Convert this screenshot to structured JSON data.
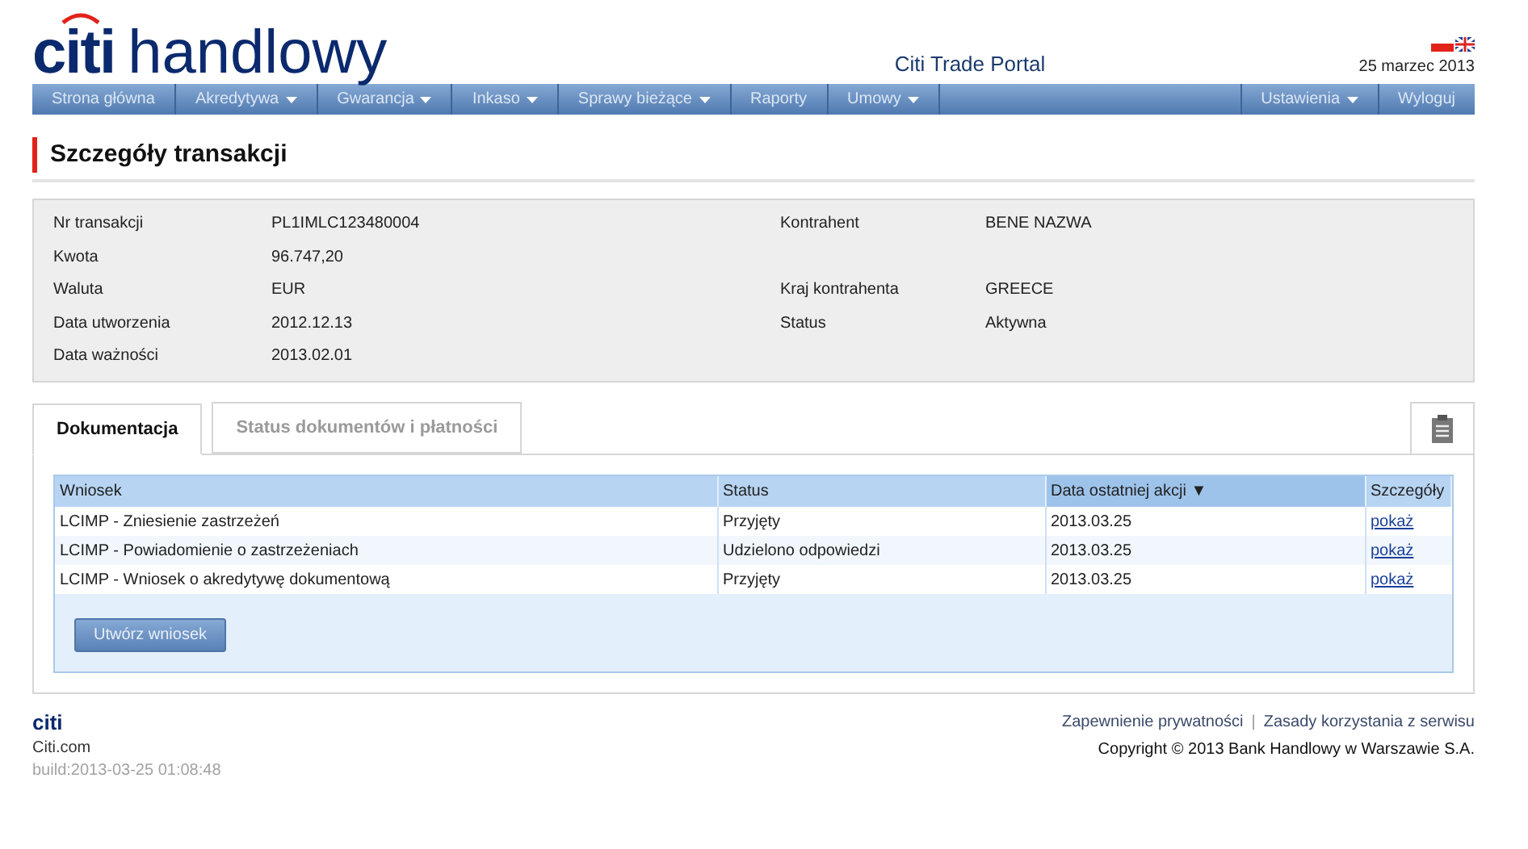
{
  "header": {
    "logo_brand": "citi",
    "logo_name": "handlowy",
    "portal_title": "Citi Trade Portal",
    "date": "25 marzec 2013"
  },
  "nav": {
    "left": [
      {
        "label": "Strona główna",
        "has_menu": false
      },
      {
        "label": "Akredytywa",
        "has_menu": true
      },
      {
        "label": "Gwarancja",
        "has_menu": true
      },
      {
        "label": "Inkaso",
        "has_menu": true
      },
      {
        "label": "Sprawy bieżące",
        "has_menu": true
      },
      {
        "label": "Raporty",
        "has_menu": false
      },
      {
        "label": "Umowy",
        "has_menu": true
      }
    ],
    "right": [
      {
        "label": "Ustawienia",
        "has_menu": true
      },
      {
        "label": "Wyloguj",
        "has_menu": false
      }
    ]
  },
  "page_title": "Szczegóły transakcji",
  "details": [
    {
      "label": "Nr transakcji",
      "value": "PL1IMLC123480004",
      "right_label": "Kontrahent",
      "right_value": "BENE NAZWA"
    },
    {
      "label": "Kwota",
      "value": "96.747,20"
    },
    {
      "label": "Waluta",
      "value": "EUR",
      "right_label": "Kraj kontrahenta",
      "right_value": "GREECE"
    },
    {
      "label": "Data utworzenia",
      "value": "2012.12.13",
      "right_label": "Status",
      "right_value": "Aktywna"
    },
    {
      "label": "Data ważności",
      "value": "2013.02.01"
    }
  ],
  "tabs": [
    {
      "label": "Dokumentacja",
      "selected": true
    },
    {
      "label": "Status dokumentów i płatności",
      "selected": false
    }
  ],
  "table": {
    "columns": [
      {
        "label": "Wniosek",
        "sorted": false
      },
      {
        "label": "Status",
        "sorted": false
      },
      {
        "label": "Data ostatniej akcji ▼",
        "sorted": true
      },
      {
        "label": "Szczegóły",
        "sorted": false
      }
    ],
    "rows": [
      {
        "request": "LCIMP - Zniesienie zastrzeżeń",
        "status": "Przyjęty",
        "date": "2013.03.25",
        "link": "pokaż"
      },
      {
        "request": "LCIMP - Powiadomienie o zastrzeżeniach",
        "status": "Udzielono odpowiedzi",
        "date": "2013.03.25",
        "link": "pokaż"
      },
      {
        "request": "LCIMP - Wniosek o akredytywę dokumentową",
        "status": "Przyjęty",
        "date": "2013.03.25",
        "link": "pokaż"
      }
    ]
  },
  "create_button": "Utwórz wniosek",
  "footer": {
    "logo": "citi",
    "site": "Citi.com",
    "build": "build:2013-03-25 01:08:48",
    "links": [
      "Zapewnienie prywatności",
      "Zasady korzystania z serwisu"
    ],
    "separator": "|",
    "copyright": "Copyright © 2013 Bank Handlowy w Warszawie S.A."
  }
}
